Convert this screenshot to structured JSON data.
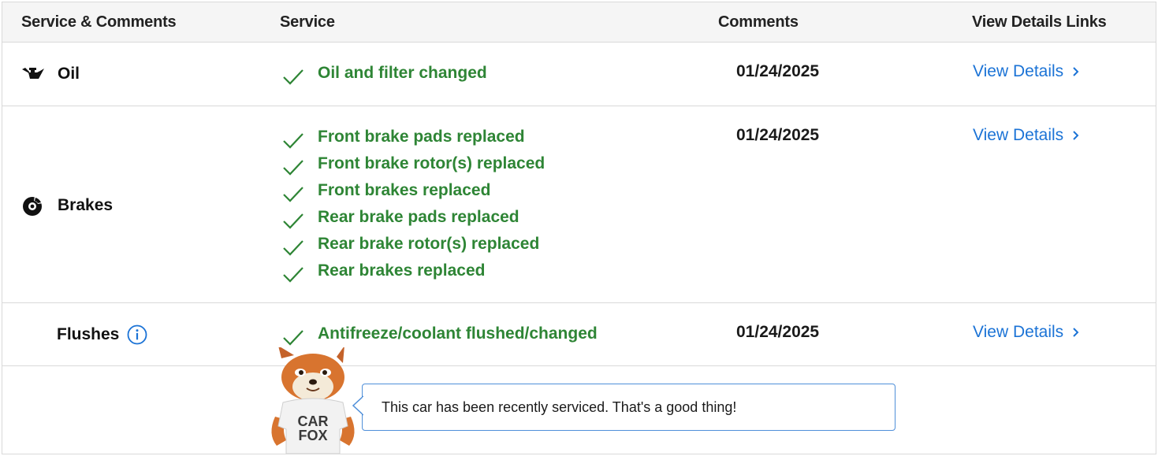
{
  "headers": {
    "category": "Service & Comments",
    "service": "Service",
    "comments": "Comments",
    "links": "View Details Links"
  },
  "rows": [
    {
      "category": "Oil",
      "icon": "oil-can-icon",
      "services": [
        "Oil and filter changed"
      ],
      "date": "01/24/2025",
      "link": "View Details"
    },
    {
      "category": "Brakes",
      "icon": "brake-disc-icon",
      "services": [
        "Front brake pads replaced",
        "Front brake rotor(s) replaced",
        "Front brakes replaced",
        "Rear brake pads replaced",
        "Rear brake rotor(s) replaced",
        "Rear brakes replaced"
      ],
      "date": "01/24/2025",
      "link": "View Details"
    },
    {
      "category": "Flushes",
      "icon": "info-icon",
      "services": [
        "Antifreeze/coolant flushed/changed"
      ],
      "date": "01/24/2025",
      "link": "View Details"
    }
  ],
  "footer": {
    "message": "This car has been recently serviced. That's a good thing!",
    "mascot": {
      "shirt_line1": "CAR",
      "shirt_line2": "FOX"
    }
  },
  "colors": {
    "service_text": "#2e8535",
    "link": "#1b73d6",
    "header_bg": "#f5f5f5",
    "bubble_border": "#4f8fd9"
  }
}
